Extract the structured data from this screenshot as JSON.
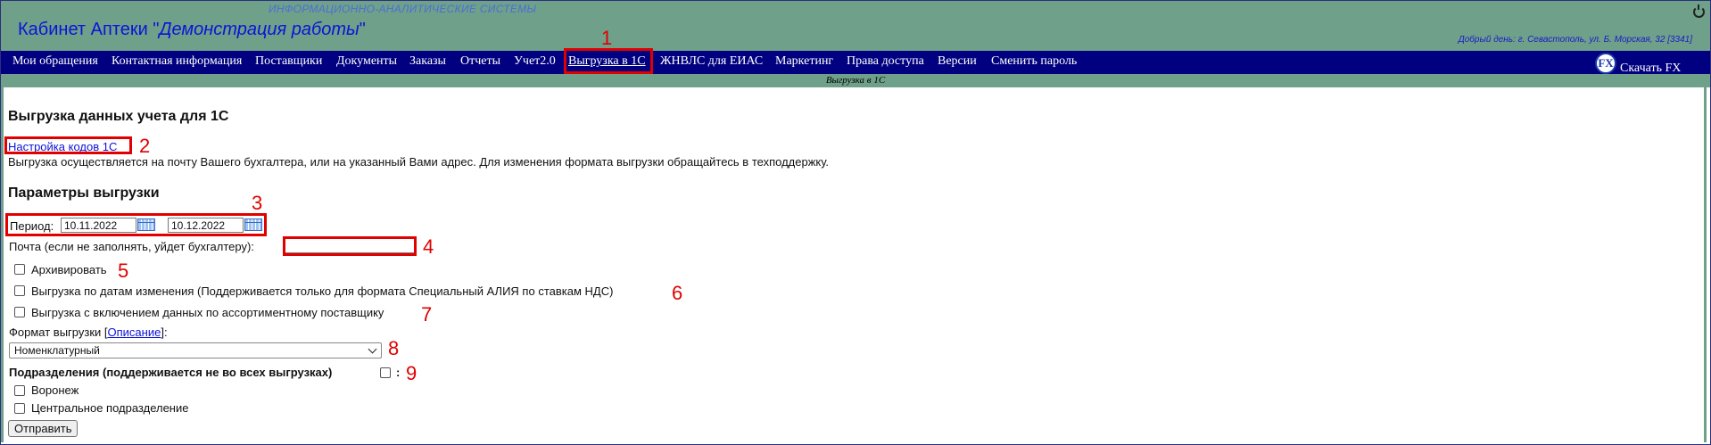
{
  "header": {
    "subtitle": "ИНФОРМАЦИОННО-АНАЛИТИЧЕСКИЕ СИСТЕМЫ",
    "title_prefix": "Кабинет Аптеки \"",
    "title_name": "Демонстрация работы",
    "title_suffix": "\"",
    "greeting": "Добрый день: г. Севастополь, ул. Б. Морская, 32 [3341]"
  },
  "nav": {
    "items": [
      "Мои обращения",
      "Контактная информация",
      "Поставщики",
      "Документы",
      "Заказы",
      "Отчеты",
      "Учет2.0",
      "Выгрузка в 1С",
      "ЖНВЛС для ЕИАС",
      "Маркетинг",
      "Права доступа",
      "Версии",
      "Сменить пароль"
    ],
    "download_label": "Скачать FX",
    "fx_text": "FX"
  },
  "subbar_title": "Выгрузка в 1С",
  "page": {
    "heading": "Выгрузка данных учета для 1С",
    "codes_link": "Настройка кодов 1С",
    "note": "Выгрузка осуществляется на почту Вашего бухгалтера, или на указанный Вами адрес. Для изменения формата выгрузки обращайтесь в техподдержку.",
    "params_heading": "Параметры выгрузки",
    "period_label": "Период:",
    "date_from": "10.11.2022",
    "date_to": "10.12.2022",
    "email_label": "Почта (если не заполнять, уйдет бухгалтеру):",
    "archive_label": "Архивировать",
    "by_change_dates_label": "Выгрузка по датам изменения (Поддерживается только для формата Специальный АЛИЯ по ставкам НДС)",
    "assortment_label": "Выгрузка с включением данных по ассортиментному поставщику",
    "format_label_prefix": "Формат выгрузки [",
    "format_link": "Описание",
    "format_label_suffix": "]:",
    "format_selected": "Номенклатурный",
    "subdivisions_label": "Подразделения (поддерживается не во всех выгрузках)",
    "subdivisions_colon": ":",
    "subdivisions": [
      "Воронеж",
      "Центральное подразделение"
    ],
    "submit_label": "Отправить"
  },
  "annotations": {
    "color": "#e00000",
    "numbers": [
      "1",
      "2",
      "3",
      "4",
      "5",
      "6",
      "7",
      "8",
      "9"
    ]
  }
}
